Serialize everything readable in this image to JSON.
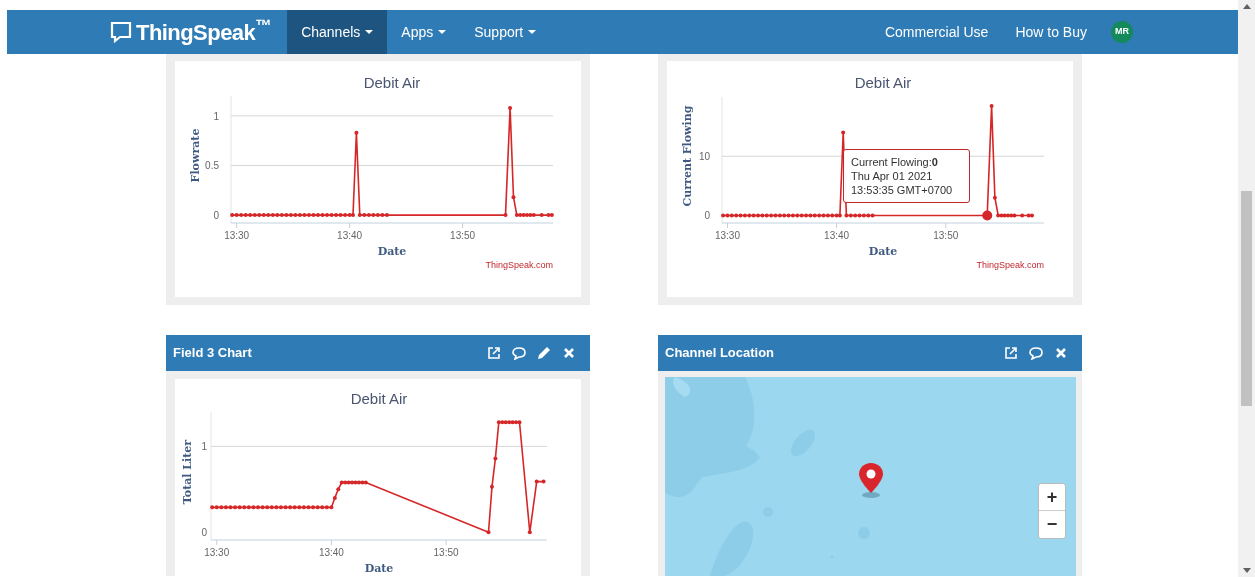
{
  "navbar": {
    "brand": "ThingSpeak$^{™}$",
    "menus": [
      {
        "label": "Channels",
        "selected": true
      },
      {
        "label": "Apps",
        "selected": false
      },
      {
        "label": "Support",
        "selected": false
      }
    ],
    "links": [
      "Commercial Use",
      "How to Buy"
    ],
    "avatar": "MR"
  },
  "panels": [
    {
      "kind": "chart",
      "credit": "ThingSpeak.com",
      "chart_data": {
        "type": "line",
        "title": "Debit Air",
        "xlabel": "Date",
        "ylabel": "Flowrate",
        "xlim": [
          809.5,
          838
        ],
        "ylim": [
          -0.08,
          1.2
        ],
        "xticks": [
          {
            "value": 810,
            "label": "13:30"
          },
          {
            "value": 820,
            "label": "13:40"
          },
          {
            "value": 830,
            "label": "13:50"
          }
        ],
        "yticks": [
          {
            "value": 0,
            "label": "0"
          },
          {
            "value": 0.5,
            "label": "0.5"
          },
          {
            "value": 1,
            "label": "1"
          }
        ],
        "x": [
          809.6,
          810,
          810.4,
          810.8,
          811.2,
          811.6,
          812,
          812.4,
          812.8,
          813.2,
          813.6,
          814,
          814.4,
          814.8,
          815.2,
          815.6,
          816,
          816.4,
          816.8,
          817.2,
          817.6,
          818,
          818.4,
          818.8,
          819.2,
          819.6,
          820,
          820.3,
          820.6,
          820.9,
          821.3,
          821.7,
          822.1,
          822.5,
          822.9,
          823.3,
          833.8,
          834.2,
          834.5,
          834.8,
          835.1,
          835.4,
          835.7,
          836,
          836.3,
          837,
          837.6,
          837.9
        ],
        "series": [
          {
            "color": "#d62728",
            "values": [
              0,
              0,
              0,
              0,
              0,
              0,
              0,
              0,
              0,
              0,
              0,
              0,
              0,
              0,
              0,
              0,
              0,
              0,
              0,
              0,
              0,
              0,
              0,
              0,
              0,
              0,
              0,
              0,
              0.83,
              0,
              0,
              0,
              0,
              0,
              0,
              0,
              0,
              1.08,
              0.18,
              0,
              0,
              0,
              0,
              0,
              0,
              0,
              0,
              0
            ]
          }
        ]
      }
    },
    {
      "kind": "chart",
      "credit": "ThingSpeak.com",
      "tooltip": {
        "lines": [
          "Current Flowing:**0**",
          "Thu Apr 01 2021",
          "13:53:35 GMT+0700"
        ]
      },
      "chart_data": {
        "type": "line",
        "title": "Debit Air",
        "xlabel": "Date",
        "ylabel": "Current Flowing",
        "xlim": [
          809.5,
          839
        ],
        "ylim": [
          -1.27,
          20
        ],
        "xticks": [
          {
            "value": 810,
            "label": "13:30"
          },
          {
            "value": 820,
            "label": "13:40"
          },
          {
            "value": 830,
            "label": "13:50"
          }
        ],
        "yticks": [
          {
            "value": 0,
            "label": "0"
          },
          {
            "value": 10,
            "label": "10"
          }
        ],
        "x": [
          809.6,
          810,
          810.4,
          810.8,
          811.2,
          811.6,
          812,
          812.4,
          812.8,
          813.2,
          813.6,
          814,
          814.4,
          814.8,
          815.2,
          815.6,
          816,
          816.4,
          816.8,
          817.2,
          817.6,
          818,
          818.4,
          818.8,
          819.2,
          819.6,
          820,
          820.3,
          820.6,
          820.9,
          821.3,
          821.7,
          822.1,
          822.5,
          822.9,
          823.3,
          833.8,
          834.2,
          834.5,
          834.8,
          835.1,
          835.4,
          835.7,
          836,
          836.3,
          837,
          837.6,
          837.9
        ],
        "series": [
          {
            "color": "#d62728",
            "values": [
              0,
              0,
              0,
              0,
              0,
              0,
              0,
              0,
              0,
              0,
              0,
              0,
              0,
              0,
              0,
              0,
              0,
              0,
              0,
              0,
              0,
              0,
              0,
              0,
              0,
              0,
              0,
              0,
              14,
              0,
              0,
              0,
              0,
              0,
              0,
              0,
              0,
              18.5,
              3,
              0,
              0,
              0,
              0,
              0,
              0,
              0,
              0,
              0
            ]
          }
        ]
      }
    },
    {
      "kind": "chart",
      "title": "Field 3 Chart",
      "editable": true,
      "chart_data": {
        "type": "line",
        "title": "Debit Air",
        "xlabel": "Date",
        "ylabel": "Total Liter",
        "xlim": [
          809.5,
          838.8
        ],
        "ylim": [
          -0.09,
          1.4
        ],
        "xticks": [
          {
            "value": 810,
            "label": "13:30"
          },
          {
            "value": 820,
            "label": "13:40"
          },
          {
            "value": 830,
            "label": "13:50"
          }
        ],
        "yticks": [
          {
            "value": 0,
            "label": "0"
          },
          {
            "value": 1,
            "label": "1"
          }
        ],
        "x": [
          809.6,
          810,
          810.4,
          810.8,
          811.2,
          811.6,
          812,
          812.4,
          812.8,
          813.2,
          813.6,
          814,
          814.4,
          814.8,
          815.2,
          815.6,
          816,
          816.4,
          816.8,
          817.2,
          817.6,
          818,
          818.4,
          818.8,
          819.2,
          819.6,
          820,
          820.3,
          820.6,
          820.9,
          821.2,
          821.5,
          821.8,
          822.1,
          822.4,
          822.7,
          823,
          833.7,
          834,
          834.3,
          834.6,
          834.9,
          835.2,
          835.5,
          835.8,
          836.1,
          836.4,
          837.3,
          837.9,
          838.5
        ],
        "series": [
          {
            "color": "#d62728",
            "values": [
              0.29,
              0.29,
              0.29,
              0.29,
              0.29,
              0.29,
              0.29,
              0.29,
              0.29,
              0.29,
              0.29,
              0.29,
              0.29,
              0.29,
              0.29,
              0.29,
              0.29,
              0.29,
              0.29,
              0.29,
              0.29,
              0.29,
              0.29,
              0.29,
              0.29,
              0.29,
              0.29,
              0.4,
              0.5,
              0.58,
              0.58,
              0.58,
              0.58,
              0.58,
              0.58,
              0.58,
              0.58,
              0,
              0.53,
              0.86,
              1.28,
              1.28,
              1.28,
              1.28,
              1.28,
              1.28,
              1.28,
              0,
              0.59,
              0.59
            ]
          }
        ]
      }
    },
    {
      "kind": "map",
      "title": "Channel Location",
      "editable": false,
      "zoom_in": "+",
      "zoom_out": "−"
    }
  ]
}
